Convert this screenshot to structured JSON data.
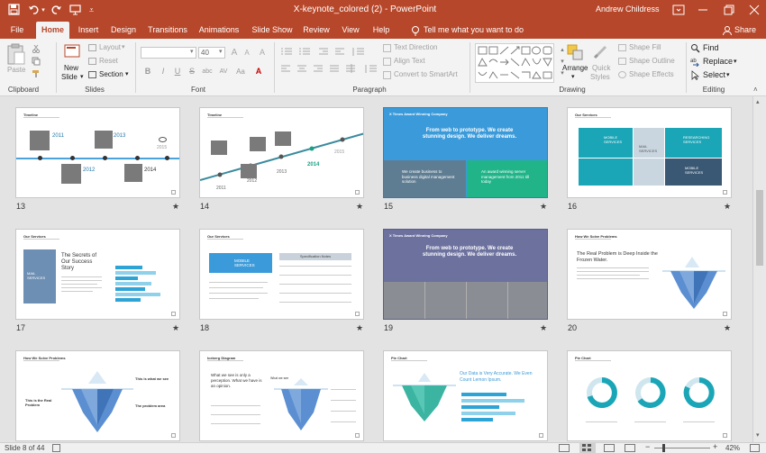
{
  "titlebar": {
    "document_title": "X-keynote_colored (2) - PowerPoint",
    "user_name": "Andrew Childress"
  },
  "quick_access": {
    "icons": [
      "save-icon",
      "undo-icon",
      "redo-icon",
      "present-from-start-icon",
      "customize-qat-icon"
    ]
  },
  "window_controls": {
    "icons": [
      "ribbon-display-options-icon",
      "minimize-icon",
      "restore-icon",
      "close-icon"
    ]
  },
  "tabs": [
    "File",
    "Home",
    "Insert",
    "Design",
    "Transitions",
    "Animations",
    "Slide Show",
    "Review",
    "View",
    "Help"
  ],
  "active_tab": "Home",
  "tell_me": "Tell me what you want to do",
  "share": "Share",
  "ribbon": {
    "clipboard": {
      "paste": "Paste",
      "group": "Clipboard"
    },
    "slides": {
      "new_slide_1": "New",
      "new_slide_2": "Slide",
      "layout": "Layout",
      "reset": "Reset",
      "section": "Section",
      "group": "Slides"
    },
    "font": {
      "font_name": "",
      "font_size": "40",
      "bold": "B",
      "italic": "I",
      "underline": "U",
      "strike": "S",
      "shadow": "abc",
      "spacing": "AV",
      "case": "Aa",
      "group": "Font"
    },
    "paragraph": {
      "text_direction": "Text Direction",
      "align_text": "Align Text",
      "smartart": "Convert to SmartArt",
      "group": "Paragraph"
    },
    "drawing": {
      "arrange": "Arrange",
      "quick_styles_1": "Quick",
      "quick_styles_2": "Styles",
      "shape_fill": "Shape Fill",
      "shape_outline": "Shape Outline",
      "shape_effects": "Shape Effects",
      "group": "Drawing"
    },
    "editing": {
      "find": "Find",
      "replace": "Replace",
      "select": "Select",
      "group": "Editing"
    }
  },
  "slides": [
    {
      "num": "13",
      "title": "Timeline",
      "years": [
        "2011",
        "2012",
        "2013",
        "2014",
        "2015"
      ]
    },
    {
      "num": "14",
      "title": "Timeline",
      "years": [
        "2011",
        "2012",
        "2013",
        "2014",
        "2015"
      ]
    },
    {
      "num": "15",
      "title": "X Times Award Winning Company",
      "headline": "From web to prototype. We create stunning design. We deliver dreams.",
      "box_left": "We create business to business digital management solution",
      "box_right": "An award winning server management from 2011 till today"
    },
    {
      "num": "16",
      "title": "Our Services",
      "tiles": [
        "MOBILE SERVICES",
        "MAIL SERVICES",
        "RESEARCHING SERVICES",
        "",
        "",
        "MOBILE SERVICES"
      ]
    },
    {
      "num": "17",
      "title": "Our Services",
      "heading": "The Secrets of Our Success Story",
      "badge": "MAIL SERVICES"
    },
    {
      "num": "18",
      "title": "Our Services",
      "badge": "MOBILE SERVICES",
      "table_head": "Specification Notes"
    },
    {
      "num": "19",
      "title": "X Times Award Winning Company",
      "headline": "From web to prototype. We create stunning design. We deliver dreams."
    },
    {
      "num": "20",
      "title": "How We Solve Problems",
      "heading": "The Real Problem is Deep Inside the Frozen Water."
    },
    {
      "num": "21",
      "title": "How We Solve Problems",
      "label_top": "This is what we see",
      "label_mid": "The problem area",
      "label_left": "This is the Real Problem"
    },
    {
      "num": "22",
      "title": "Iceberg Diagram",
      "heading": "What we see is only a perception. What we have is an opinion.",
      "label": "What we see"
    },
    {
      "num": "23",
      "title": "Pie Chart",
      "heading": "Our Data is Very Accurate. We Even Count Lemon Ipsum."
    },
    {
      "num": "24",
      "title": "Pie Chart"
    }
  ],
  "status": {
    "slide_info": "Slide 8 of 44",
    "zoom": "42%",
    "icons": [
      "spellcheck-icon",
      "normal-view-icon",
      "slide-sorter-view-icon",
      "reading-view-icon",
      "slideshow-view-icon",
      "fit-to-window-icon"
    ]
  }
}
